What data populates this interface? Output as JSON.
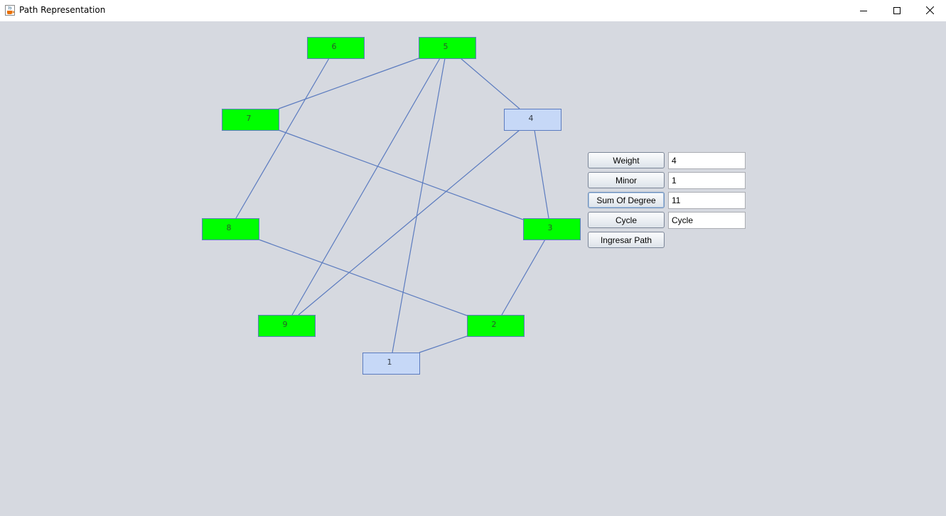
{
  "window": {
    "title": "Path Representation",
    "icon": "java-cup-icon",
    "controls": [
      "minimize-icon",
      "maximize-icon",
      "close-icon"
    ]
  },
  "colors": {
    "background": "#d6d9e0",
    "node_green": "#00ff00",
    "node_blue": "#c6d8f7",
    "edge": "#5b7bbf"
  },
  "graph": {
    "nodes": [
      {
        "id": "1",
        "label": "1",
        "fill": "blue"
      },
      {
        "id": "2",
        "label": "2",
        "fill": "green"
      },
      {
        "id": "3",
        "label": "3",
        "fill": "green"
      },
      {
        "id": "4",
        "label": "4",
        "fill": "blue"
      },
      {
        "id": "5",
        "label": "5",
        "fill": "green"
      },
      {
        "id": "6",
        "label": "6",
        "fill": "green"
      },
      {
        "id": "7",
        "label": "7",
        "fill": "green"
      },
      {
        "id": "8",
        "label": "8",
        "fill": "green"
      },
      {
        "id": "9",
        "label": "9",
        "fill": "green"
      }
    ],
    "edges": [
      [
        "6",
        "8"
      ],
      [
        "5",
        "7"
      ],
      [
        "5",
        "4"
      ],
      [
        "5",
        "9"
      ],
      [
        "5",
        "1"
      ],
      [
        "7",
        "3"
      ],
      [
        "4",
        "9"
      ],
      [
        "4",
        "3"
      ],
      [
        "8",
        "2"
      ],
      [
        "3",
        "2"
      ],
      [
        "2",
        "1"
      ]
    ]
  },
  "controls": {
    "weight": {
      "label": "Weight",
      "value": "4"
    },
    "minor": {
      "label": "Minor",
      "value": "1"
    },
    "sum_of_degree": {
      "label": "Sum Of Degree",
      "value": "11"
    },
    "cycle": {
      "label": "Cycle",
      "value": "Cycle"
    },
    "ingresar_path": {
      "label": "Ingresar Path"
    }
  }
}
